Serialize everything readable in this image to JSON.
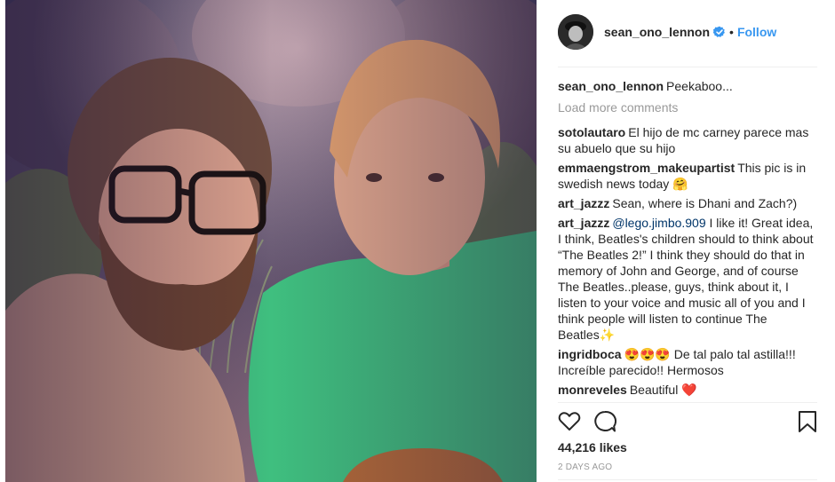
{
  "post": {
    "author": "sean_ono_lennon",
    "dot": "•",
    "follow_label": "Follow",
    "caption_text": "Peekaboo...",
    "load_more": "Load more comments",
    "comments": [
      {
        "user": "sotolautaro",
        "text": "El hijo de mc carney parece mas su abuelo que su hijo"
      },
      {
        "user": "emmaengstrom_makeupartist",
        "text": "This pic is in swedish news today 🤗"
      },
      {
        "user": "art_jazzz",
        "text": "Sean, where is Dhani and Zach?)"
      },
      {
        "user": "art_jazzz",
        "mention": "@lego.jimbo.909",
        "text": "I like it! Great idea, I think, Beatles's children should to think about “The Beatles 2!” I think they should do that in memory of John and George, and of course The Beatles..please, guys, think about it, I listen to your voice and music all of you and I think people will listen to continue The Beatles✨"
      },
      {
        "user": "ingridboca",
        "text": "😍😍😍 De tal palo tal astilla!!! Increíble parecido!! Hermosos"
      },
      {
        "user": "monreveles",
        "text": "Beautiful ❤️"
      }
    ],
    "likes": "44,216 likes",
    "timestamp": "2 DAYS AGO"
  },
  "icons": {
    "verified": "verified-badge-icon",
    "like": "heart-icon",
    "comment": "comment-bubble-icon",
    "save": "bookmark-icon"
  },
  "colors": {
    "link_blue": "#3897f0",
    "muted": "#999999",
    "text": "#262626"
  }
}
